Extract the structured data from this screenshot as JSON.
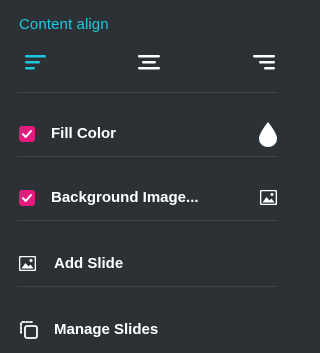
{
  "content_align": {
    "title": "Content align",
    "options": [
      {
        "name": "left",
        "icon": "align-left-icon",
        "active": true
      },
      {
        "name": "center",
        "icon": "align-center-icon",
        "active": false
      },
      {
        "name": "right",
        "icon": "align-right-icon",
        "active": false
      }
    ]
  },
  "fill_color": {
    "label": "Fill Color",
    "checked": true,
    "icon": "droplet-icon"
  },
  "background_image": {
    "label": "Background Image...",
    "checked": true,
    "icon": "image-icon"
  },
  "add_slide": {
    "label": "Add Slide",
    "icon": "image-icon"
  },
  "manage_slides": {
    "label": "Manage Slides",
    "icon": "manage-slides-icon"
  },
  "colors": {
    "background": "#2b3134",
    "accent_cyan": "#1ec8e0",
    "checkbox_pink": "#e6197d",
    "divider": "#3d4549",
    "text": "#ffffff"
  }
}
